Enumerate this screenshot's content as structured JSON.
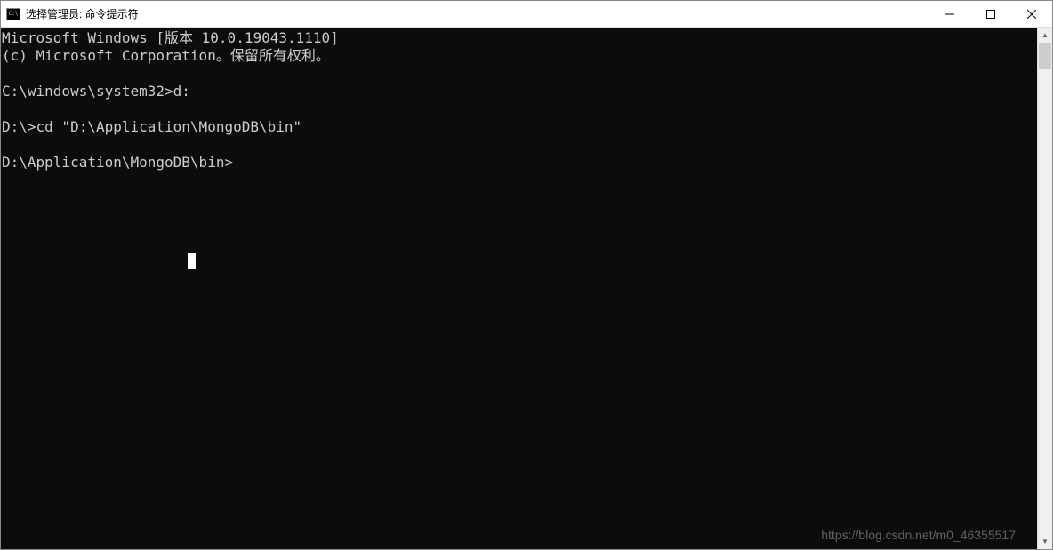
{
  "window": {
    "title": "选择管理员: 命令提示符"
  },
  "terminal": {
    "lines": [
      "Microsoft Windows [版本 10.0.19043.1110]",
      "(c) Microsoft Corporation。保留所有权利。",
      "",
      "C:\\windows\\system32>d:",
      "",
      "D:\\>cd \"D:\\Application\\MongoDB\\bin\"",
      "",
      "D:\\Application\\MongoDB\\bin>"
    ]
  },
  "watermark": "https://blog.csdn.net/m0_46355517"
}
